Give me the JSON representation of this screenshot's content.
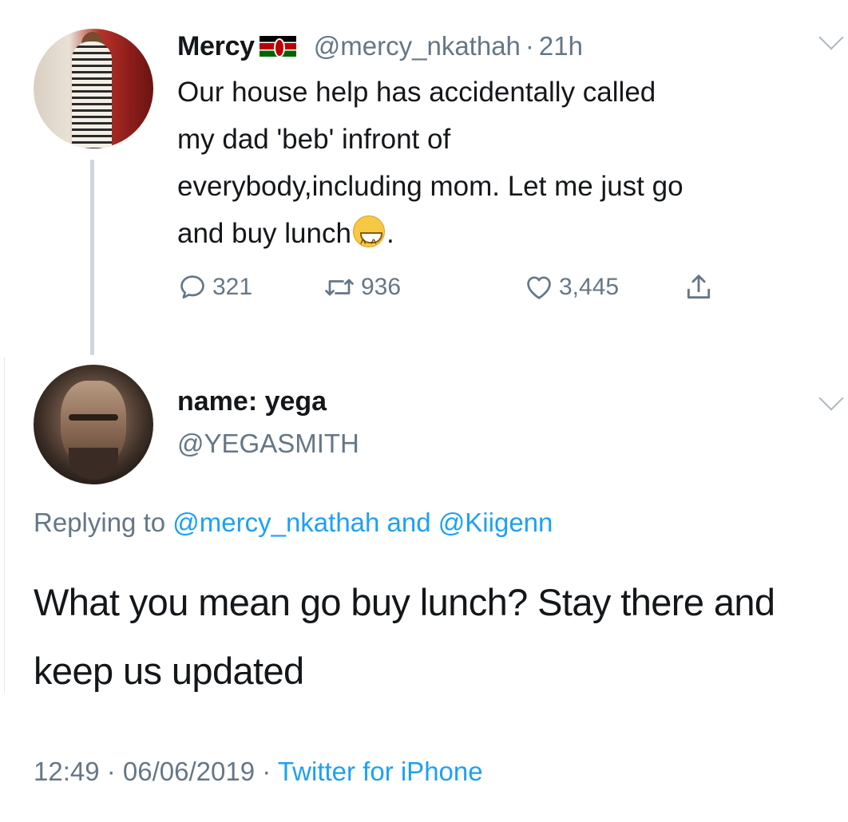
{
  "tweet": {
    "name": "Mercy",
    "flag_icon": "kenya-flag-icon",
    "handle": "@mercy_nkathah",
    "separator": "·",
    "time": "21h",
    "body_lines": [
      "Our house help has accidentally called",
      "my dad 'beb' infront of",
      "everybody,including mom. Let me just go",
      "and buy lunch"
    ],
    "body_end": ".",
    "emoji": "grinning-face-emoji",
    "replies": "321",
    "retweets": "936",
    "likes": "3,445"
  },
  "reply": {
    "name": "name: yega",
    "handle": "@YEGASMITH",
    "replying_prefix": "Replying to ",
    "replying_to_1": "@mercy_nkathah",
    "replying_and": " and ",
    "replying_to_2": "@Kiigenn",
    "body": "What you mean go buy lunch? Stay there and keep us updated",
    "time": "12:49",
    "sep1": " · ",
    "date": "06/06/2019",
    "sep2": " · ",
    "source": "Twitter for iPhone"
  },
  "colors": {
    "text": "#14171a",
    "secondary": "#657786",
    "link": "#1da1f2"
  }
}
